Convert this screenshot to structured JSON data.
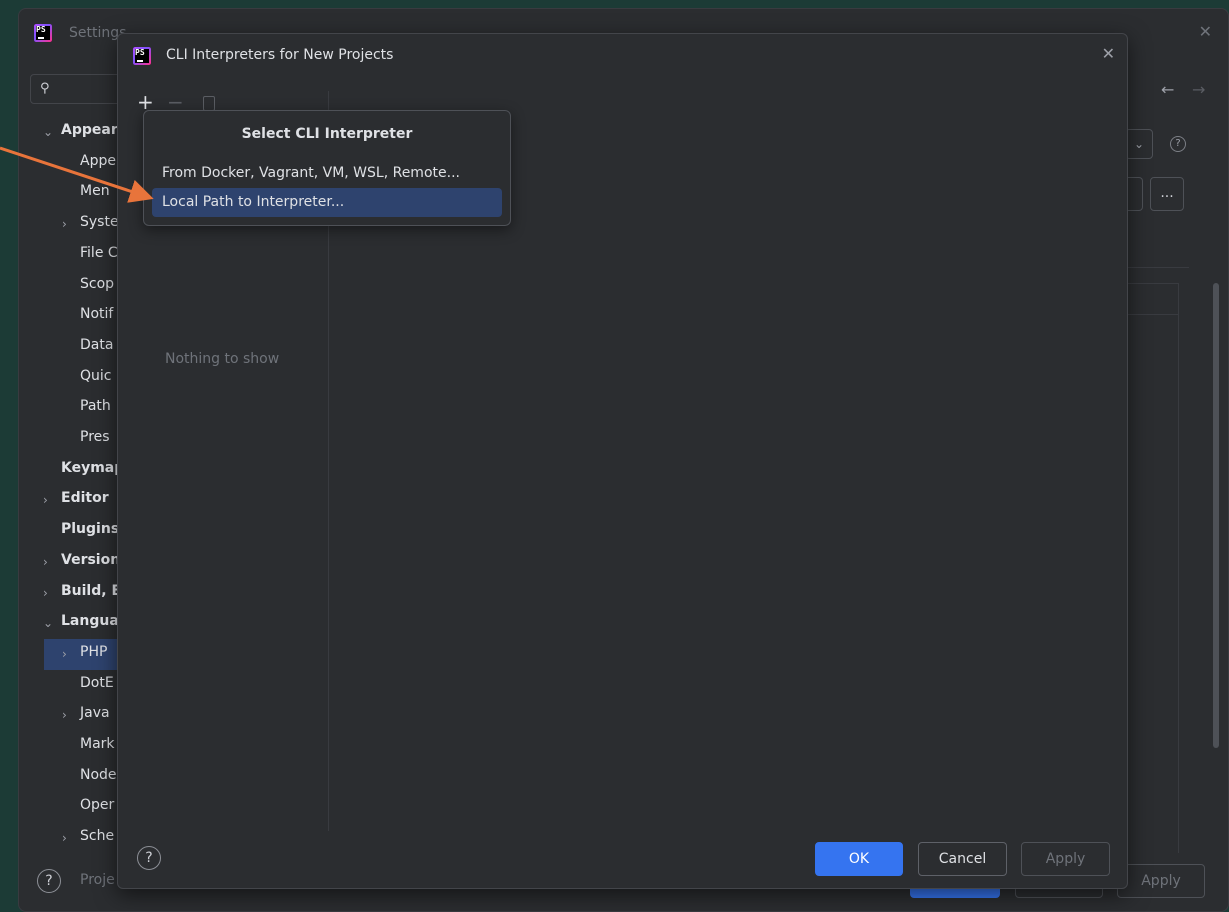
{
  "background_window": {
    "title": "Settings",
    "search_placeholder": "Q",
    "tree": [
      {
        "label": "Appearance",
        "chev": "v"
      },
      {
        "label": "Appe"
      },
      {
        "label": "Men"
      },
      {
        "label": "Syste",
        "chev": ">"
      },
      {
        "label": "File C"
      },
      {
        "label": "Scop"
      },
      {
        "label": "Notif"
      },
      {
        "label": "Data"
      },
      {
        "label": "Quic"
      },
      {
        "label": "Path"
      },
      {
        "label": "Pres"
      },
      {
        "label": "Keymap"
      },
      {
        "label": "Editor",
        "chev": ">"
      },
      {
        "label": "Plugins"
      },
      {
        "label": "Version",
        "chev": ">"
      },
      {
        "label": "Build, E",
        "chev": ">"
      },
      {
        "label": "Langua",
        "chev": "v"
      },
      {
        "label": "PHP",
        "chev": ">",
        "selected": true
      },
      {
        "label": "DotE"
      },
      {
        "label": "Java",
        "chev": ">"
      },
      {
        "label": "Mark"
      },
      {
        "label": "Node"
      },
      {
        "label": "Oper"
      },
      {
        "label": "Sche",
        "chev": ">"
      }
    ],
    "footer_project": "Proje",
    "apply_label": "Apply",
    "dots_label": "..."
  },
  "dialog": {
    "title": "CLI Interpreters for New Projects",
    "empty_text": "Nothing to show",
    "ok_label": "OK",
    "cancel_label": "Cancel",
    "apply_label": "Apply",
    "help_label": "?"
  },
  "popup": {
    "title": "Select CLI Interpreter",
    "items": [
      {
        "label": "From Docker, Vagrant, VM, WSL, Remote..."
      },
      {
        "label": "Local Path to Interpreter...",
        "selected": true
      }
    ]
  },
  "colors": {
    "accent": "#3574f0",
    "selection": "#2e436e",
    "annotation_arrow": "#e8743b"
  }
}
